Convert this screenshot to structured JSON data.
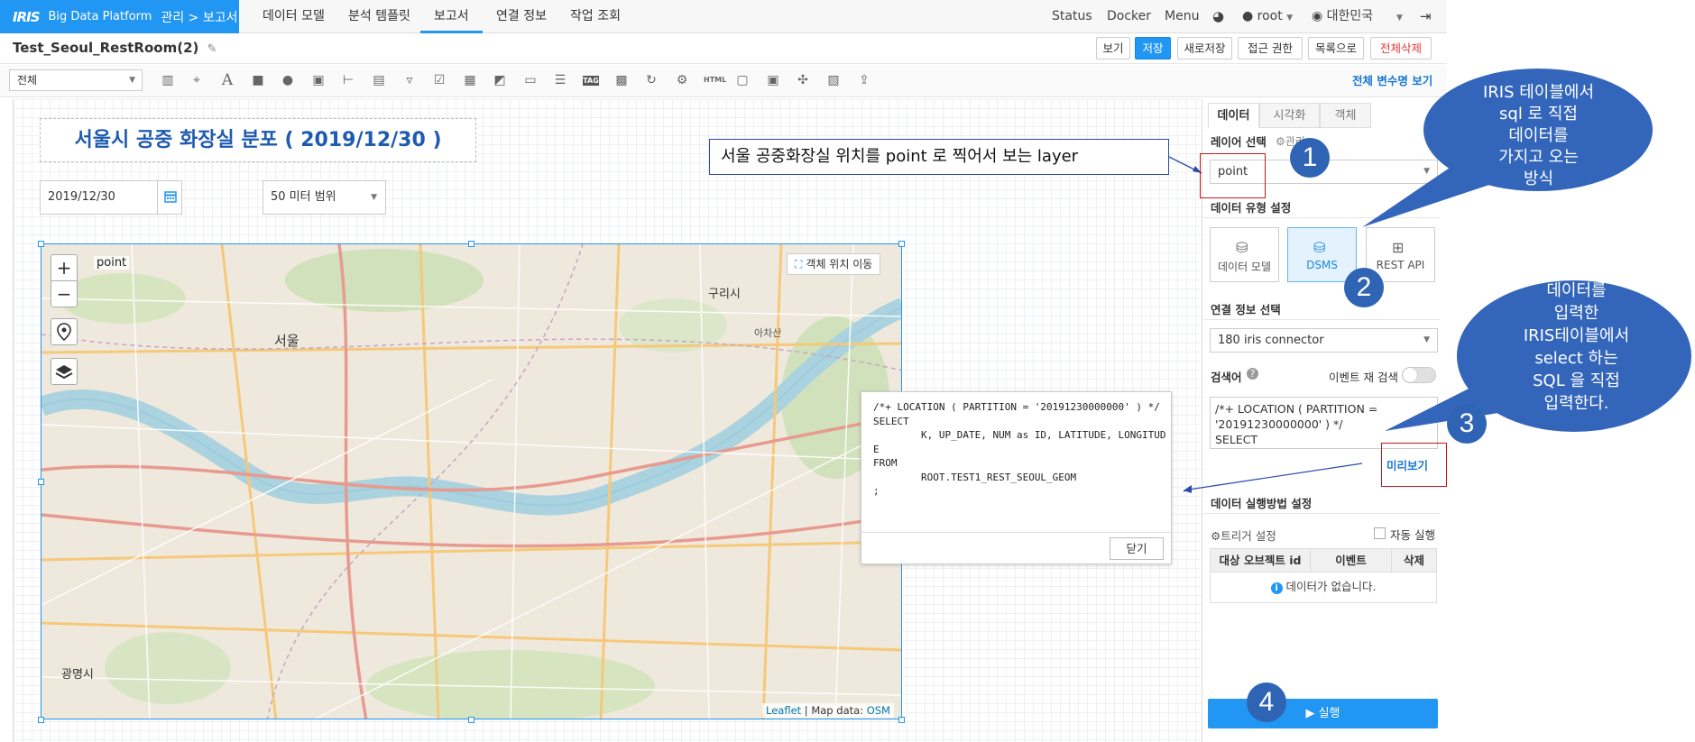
{
  "nav": {
    "logo": "IRIS",
    "platform": "Big Data Platform",
    "breadcrumb": "관리 > 보고서",
    "items": [
      "데이터 모델",
      "분석 템플릿",
      "보고서",
      "연결 정보",
      "작업 조회"
    ],
    "active_index": 2,
    "right": {
      "status": "Status",
      "docker": "Docker",
      "menu": "Menu",
      "user": "root",
      "region": "대한민국"
    }
  },
  "doc": {
    "title": "Test_Seoul_RestRoom(2)",
    "buttons": {
      "view": "보기",
      "save": "저장",
      "save_new": "새로저장",
      "access": "접근 권한",
      "list": "목록으로",
      "delete_all": "전체삭제"
    }
  },
  "toolbar": {
    "scope_select": "전체",
    "var_link": "전체 변수명 보기",
    "tools": [
      "bar-chart-icon",
      "map-icon",
      "text-icon",
      "rect-icon",
      "circle-icon",
      "image-icon",
      "slider-icon",
      "label-icon",
      "dropdown-icon",
      "checkbox-icon",
      "calendar-icon",
      "tab-icon",
      "folder-icon",
      "list-icon",
      "tag-icon",
      "schedule-icon",
      "refresh-icon",
      "settings-icon",
      "html-icon",
      "frame-icon",
      "window-icon",
      "split-icon",
      "gallery-icon",
      "export-icon"
    ]
  },
  "report": {
    "title": "서울시 공중 화장실 분포 ( 2019/12/30 )",
    "date": "2019/12/30",
    "range": "50 미터 범위"
  },
  "map": {
    "zoom_in": "+",
    "zoom_out": "−",
    "layer_label": "point",
    "move_button": "객체 위치 이동",
    "attribution_leaflet": "Leaflet",
    "attribution_sep": " | Map data: ",
    "attribution_osm": "OSM",
    "places": [
      "서울",
      "구리시",
      "광명시",
      "아차산"
    ]
  },
  "sql_popup": {
    "text": "/*+ LOCATION ( PARTITION = '20191230000000' ) */\nSELECT\n        K, UP_DATE, NUM as ID, LATITUDE, LONGITUDE\nFROM\n        ROOT.TEST1_REST_SEOUL_GEOM\n;",
    "close": "닫기"
  },
  "panel": {
    "tabs": [
      "데이터",
      "시각화",
      "객체"
    ],
    "layer_section": "레이어 선택",
    "layer_manage": "관리",
    "layer_value": "point",
    "data_type_section": "데이터 유형 설정",
    "data_types": [
      "데이터 모델",
      "DSMS",
      "REST API"
    ],
    "conn_section": "연결 정보 선택",
    "conn_value": "180 iris connector",
    "query_section": "검색어",
    "event_research": "이벤트 재 검색",
    "query_text": "/*+ LOCATION ( PARTITION = '20191230000000' ) */\nSELECT",
    "preview": "미리보기",
    "exec_section": "데이터 실행방법 설정",
    "trigger": "트리거 설정",
    "auto_run": "자동 실행",
    "table_headers": [
      "대상 오브젝트 id",
      "이벤트",
      "삭제"
    ],
    "empty": "데이터가 없습니다.",
    "run": "▶ 실행"
  },
  "annotations": {
    "layer_note": "서울 공중화장실 위치를 point 로 찍어서 보는 layer",
    "callout_sql": "IRIS 테이블에서\nsql 로 직접\n데이터를\n가지고 오는\n방식",
    "callout_input": "데이터를\n입력한\nIRIS테이블에서\nselect 하는\nSQL 을 직접\n입력한다.",
    "steps": [
      "1",
      "2",
      "3",
      "4"
    ]
  },
  "colors": {
    "accent": "#2196f3",
    "callout": "#3366bb",
    "highlight": "#c0161b"
  }
}
